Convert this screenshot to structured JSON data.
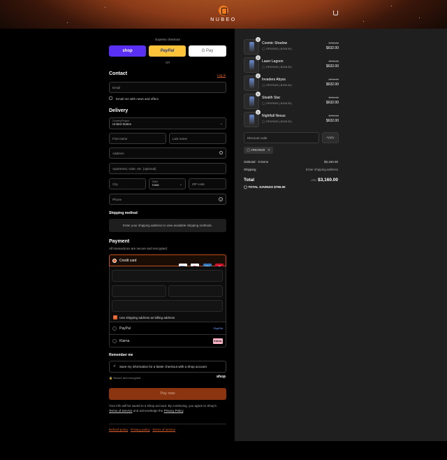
{
  "brand": {
    "name": "NUBEO"
  },
  "express": {
    "title": "Express checkout",
    "shop": "shop",
    "paypal": "PayPal",
    "gpay": "G Pay",
    "or": "OR"
  },
  "contact": {
    "title": "Contact",
    "login": "Log in",
    "email_placeholder": "Email",
    "newsletter": "Email me with news and offers"
  },
  "delivery": {
    "title": "Delivery",
    "country_label": "Country/Region",
    "country_value": "United States",
    "first_name": "First name",
    "last_name": "Last name",
    "address": "Address",
    "apartment": "Apartment, suite, etc. (optional)",
    "city": "City",
    "state_label": "State",
    "state_value": "Iowa",
    "zip": "ZIP code",
    "phone": "Phone"
  },
  "shipping_method": {
    "title": "Shipping method",
    "note": "Enter your shipping address to view available shipping methods."
  },
  "payment": {
    "title": "Payment",
    "subtitle": "All transactions are secure and encrypted.",
    "credit_card": "Credit card",
    "cards": [
      "VISA",
      "MC",
      "AMEX",
      "UP"
    ],
    "billing_same": "Use shipping address as billing address",
    "paypal": "PayPal",
    "paypal_logo": "PayPal",
    "klarna": "Klarna",
    "klarna_logo": "Klarna."
  },
  "remember": {
    "title": "Remember me",
    "save_info": "Save my information for a faster checkout with a Shop account",
    "secure": "Secure and encrypted",
    "shop": "shop"
  },
  "pay_now": "Pay now",
  "terms": {
    "line1": "Your info will be saved to a Shop account. By continuing, you agree to Shop's",
    "tos": "Terms of Service",
    "mid": " and acknowledge the ",
    "privacy": "Privacy Policy",
    "end": "."
  },
  "footer_links": [
    "Refund policy",
    "Privacy policy",
    "Terms of service"
  ],
  "cart": {
    "items": [
      {
        "name": "Cosmic Shadow",
        "qty": "1",
        "discount": "ORION20 (-$158.00)",
        "old": "$790.00",
        "price": "$632.00"
      },
      {
        "name": "Laser Lagoon",
        "qty": "1",
        "discount": "ORION20 (-$158.00)",
        "old": "$790.00",
        "price": "$632.00"
      },
      {
        "name": "Invaders Abyss",
        "qty": "1",
        "discount": "ORION20 (-$158.00)",
        "old": "$790.00",
        "price": "$632.00"
      },
      {
        "name": "Stealth Star",
        "qty": "1",
        "discount": "ORION20 (-$158.00)",
        "old": "$790.00",
        "price": "$632.00"
      },
      {
        "name": "Nightfall Nexus",
        "qty": "1",
        "discount": "ORION20 (-$158.00)",
        "old": "$790.00",
        "price": "$632.00"
      }
    ],
    "discount_placeholder": "Discount code",
    "apply": "Apply",
    "code_tag": "ORION20",
    "subtotal_label": "Subtotal · 5 items",
    "subtotal_value": "$3,160.00",
    "shipping_label": "Shipping",
    "shipping_value": "Enter shipping address",
    "total_label": "Total",
    "currency": "USD",
    "total_value": "$3,160.00",
    "savings_label": "TOTAL SAVINGS",
    "savings_value": "$790.00"
  }
}
